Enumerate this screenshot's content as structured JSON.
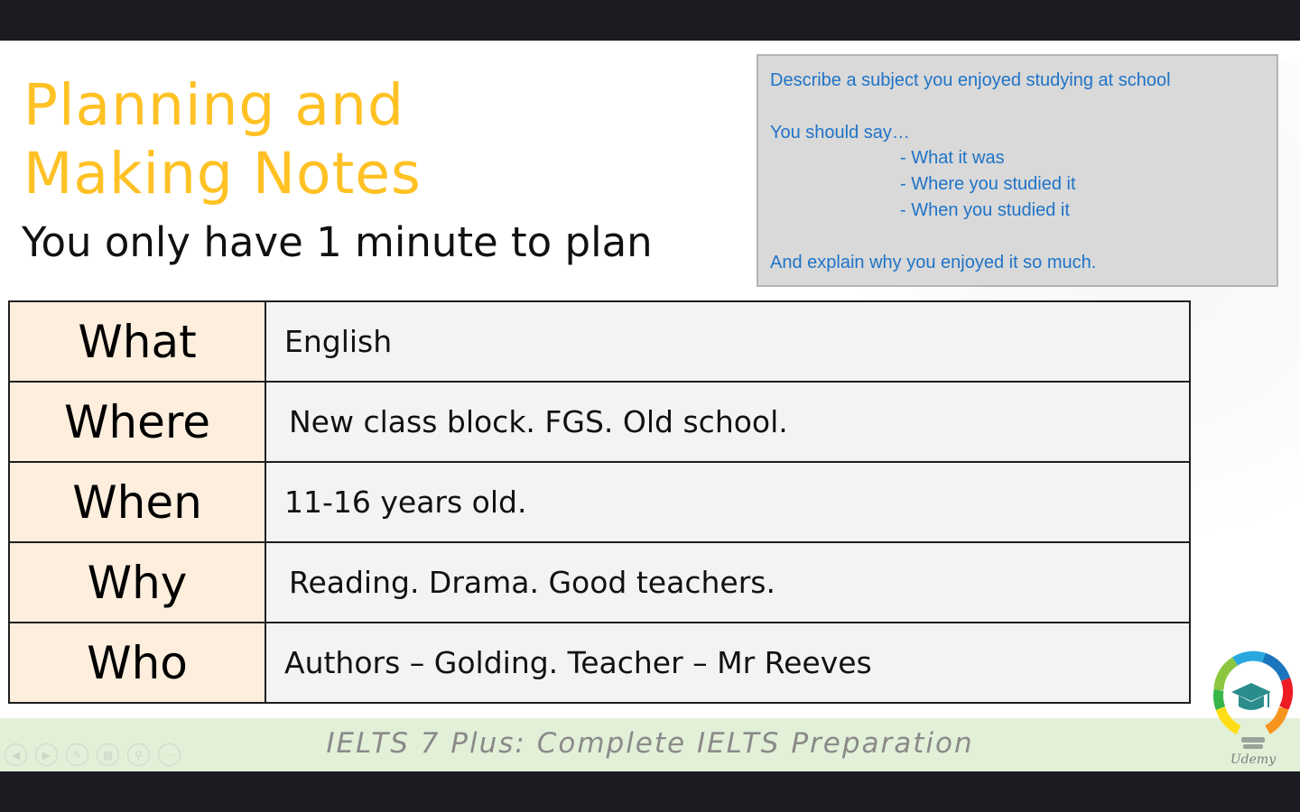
{
  "slide": {
    "title_lines": [
      "Planning and",
      "Making Notes"
    ],
    "subtitle": "You only have 1 minute to plan"
  },
  "prompt_card": {
    "heading": "Describe a subject you enjoyed studying at school",
    "should_say": "You should say…",
    "bullets": [
      "- What it was",
      "- Where you studied it",
      "- When you studied it"
    ],
    "explain": "And explain why you enjoyed it so much."
  },
  "notes_table": {
    "rows": [
      {
        "label": "What",
        "value": "English"
      },
      {
        "label": "Where",
        "value": "New class block. FGS. Old school."
      },
      {
        "label": "When",
        "value": "11-16 years old."
      },
      {
        "label": "Why",
        "value": "Reading. Drama. Good teachers."
      },
      {
        "label": "Who",
        "value": "Authors – Golding. Teacher – Mr Reeves"
      }
    ]
  },
  "footer": {
    "course_title": "IELTS 7 Plus: Complete IELTS Preparation"
  },
  "logo": {
    "brand_text": "Udemy"
  },
  "controls": {
    "icons": [
      "previous-icon",
      "next-icon",
      "pen-icon",
      "slides-icon",
      "zoom-icon",
      "more-icon"
    ]
  },
  "colors": {
    "title": "#ffc124",
    "prompt_text": "#1f73c7",
    "label_cell": "#fdeedd",
    "value_cell": "#f3f3f3",
    "footer_bar": "#e3f0d8"
  }
}
